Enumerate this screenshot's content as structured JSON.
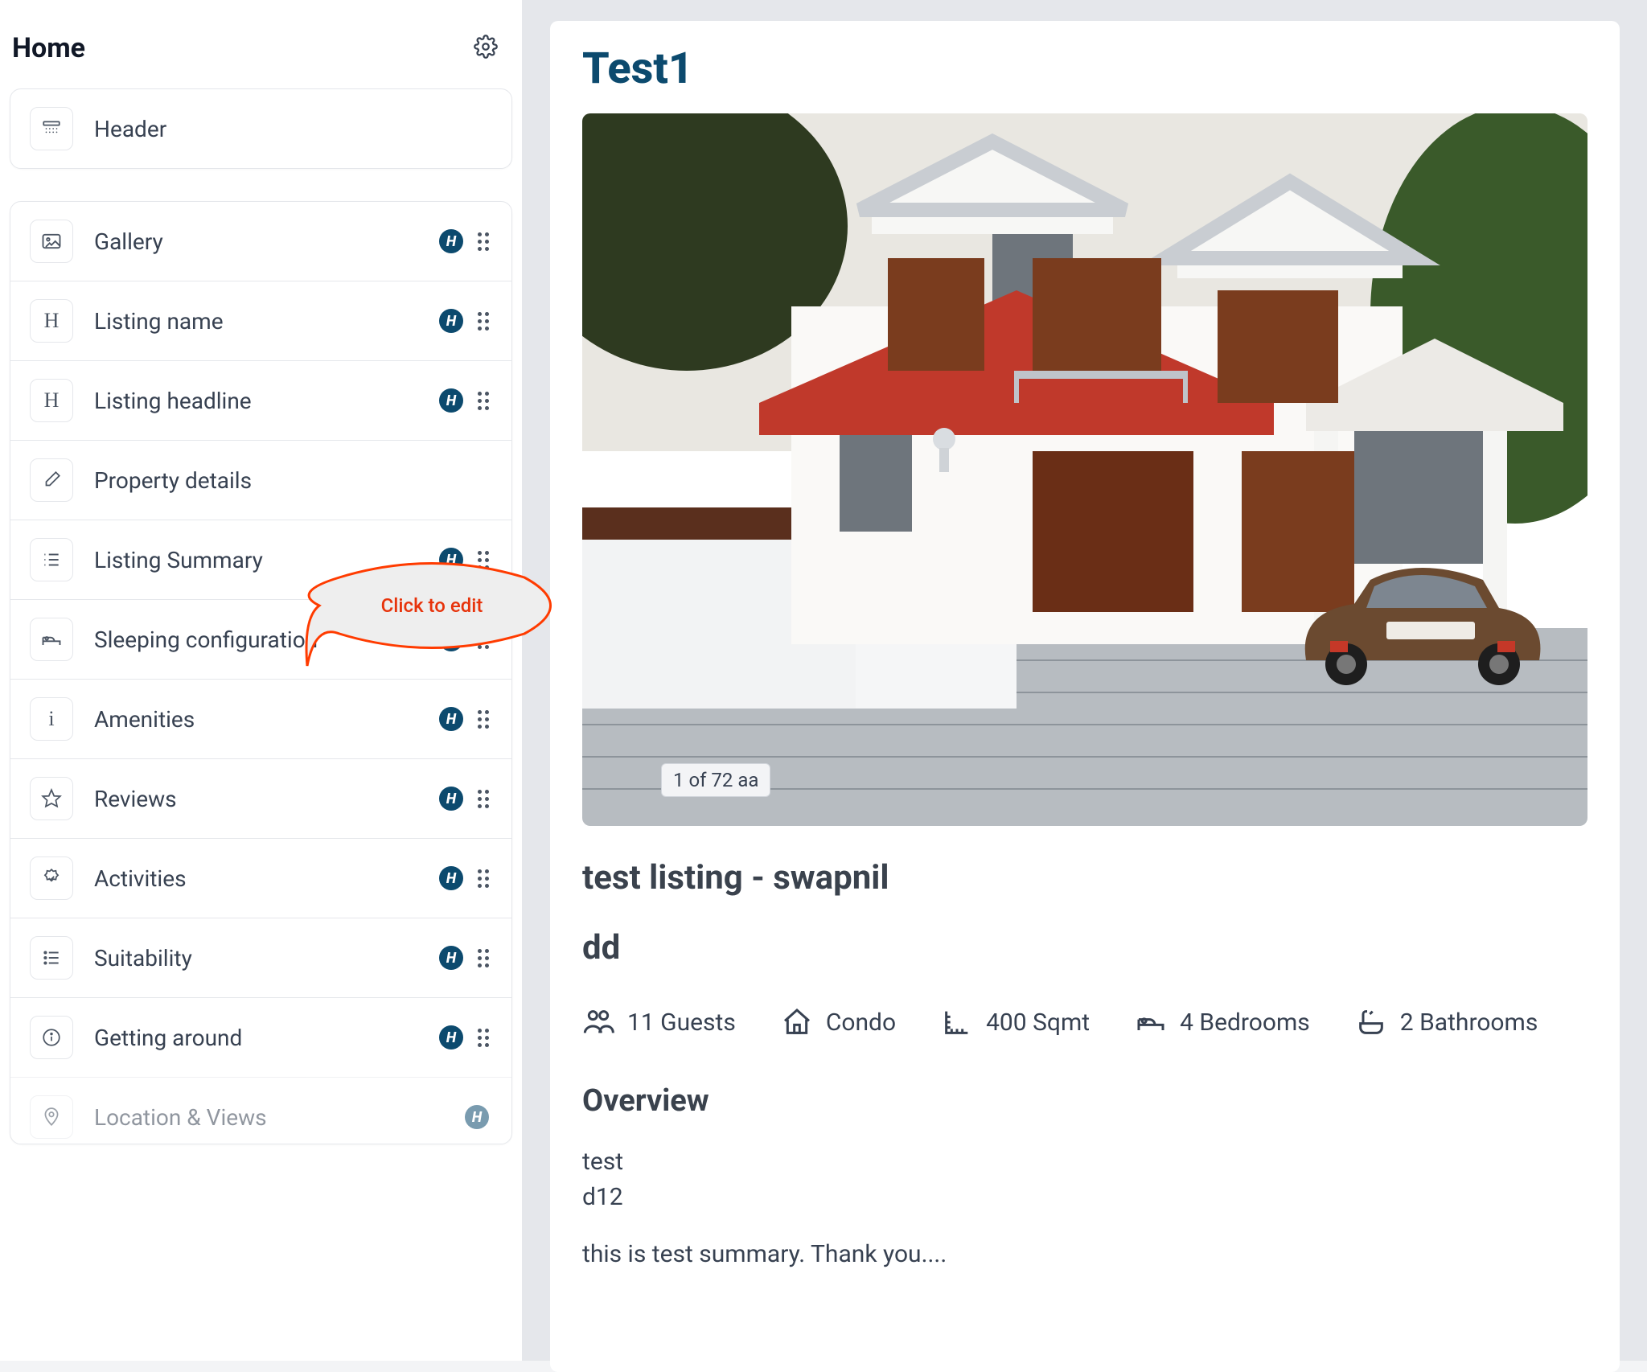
{
  "sidebar": {
    "title": "Home",
    "header_item": {
      "label": "Header"
    },
    "items": [
      {
        "label": "Gallery",
        "icon": "gallery-icon",
        "badge": true,
        "dots": true
      },
      {
        "label": "Listing name",
        "icon": "h-icon",
        "badge": true,
        "dots": true
      },
      {
        "label": "Listing headline",
        "icon": "h-icon",
        "badge": true,
        "dots": true
      },
      {
        "label": "Property details",
        "icon": "pencil-icon",
        "badge": false,
        "dots": false
      },
      {
        "label": "Listing Summary",
        "icon": "list-icon",
        "badge": true,
        "dots": true
      },
      {
        "label": "Sleeping configuration",
        "icon": "bed-icon",
        "badge": true,
        "dots": true
      },
      {
        "label": "Amenities",
        "icon": "info-icon",
        "badge": true,
        "dots": true
      },
      {
        "label": "Reviews",
        "icon": "star-icon",
        "badge": true,
        "dots": true
      },
      {
        "label": "Activities",
        "icon": "check-badge-icon",
        "badge": true,
        "dots": true
      },
      {
        "label": "Suitability",
        "icon": "list-icon",
        "badge": true,
        "dots": true
      },
      {
        "label": "Getting around",
        "icon": "info-circle-icon",
        "badge": true,
        "dots": true
      },
      {
        "label": "Location & Views",
        "icon": "pin-icon",
        "badge": true,
        "dots": false,
        "faded": true
      }
    ]
  },
  "callout": {
    "text": "Click to edit"
  },
  "main": {
    "title": "Test1",
    "image_counter": "1 of 72 aa",
    "listing_heading": "test listing - swapnil",
    "subhead": "dd",
    "stats": {
      "guests": "11 Guests",
      "type": "Condo",
      "area": "400 Sqmt",
      "bedrooms": "4 Bedrooms",
      "bathrooms": "2 Bathrooms"
    },
    "overview_title": "Overview",
    "overview_line1": "test",
    "overview_line2": "d12",
    "overview_line3": "this is test summary. Thank you...."
  }
}
